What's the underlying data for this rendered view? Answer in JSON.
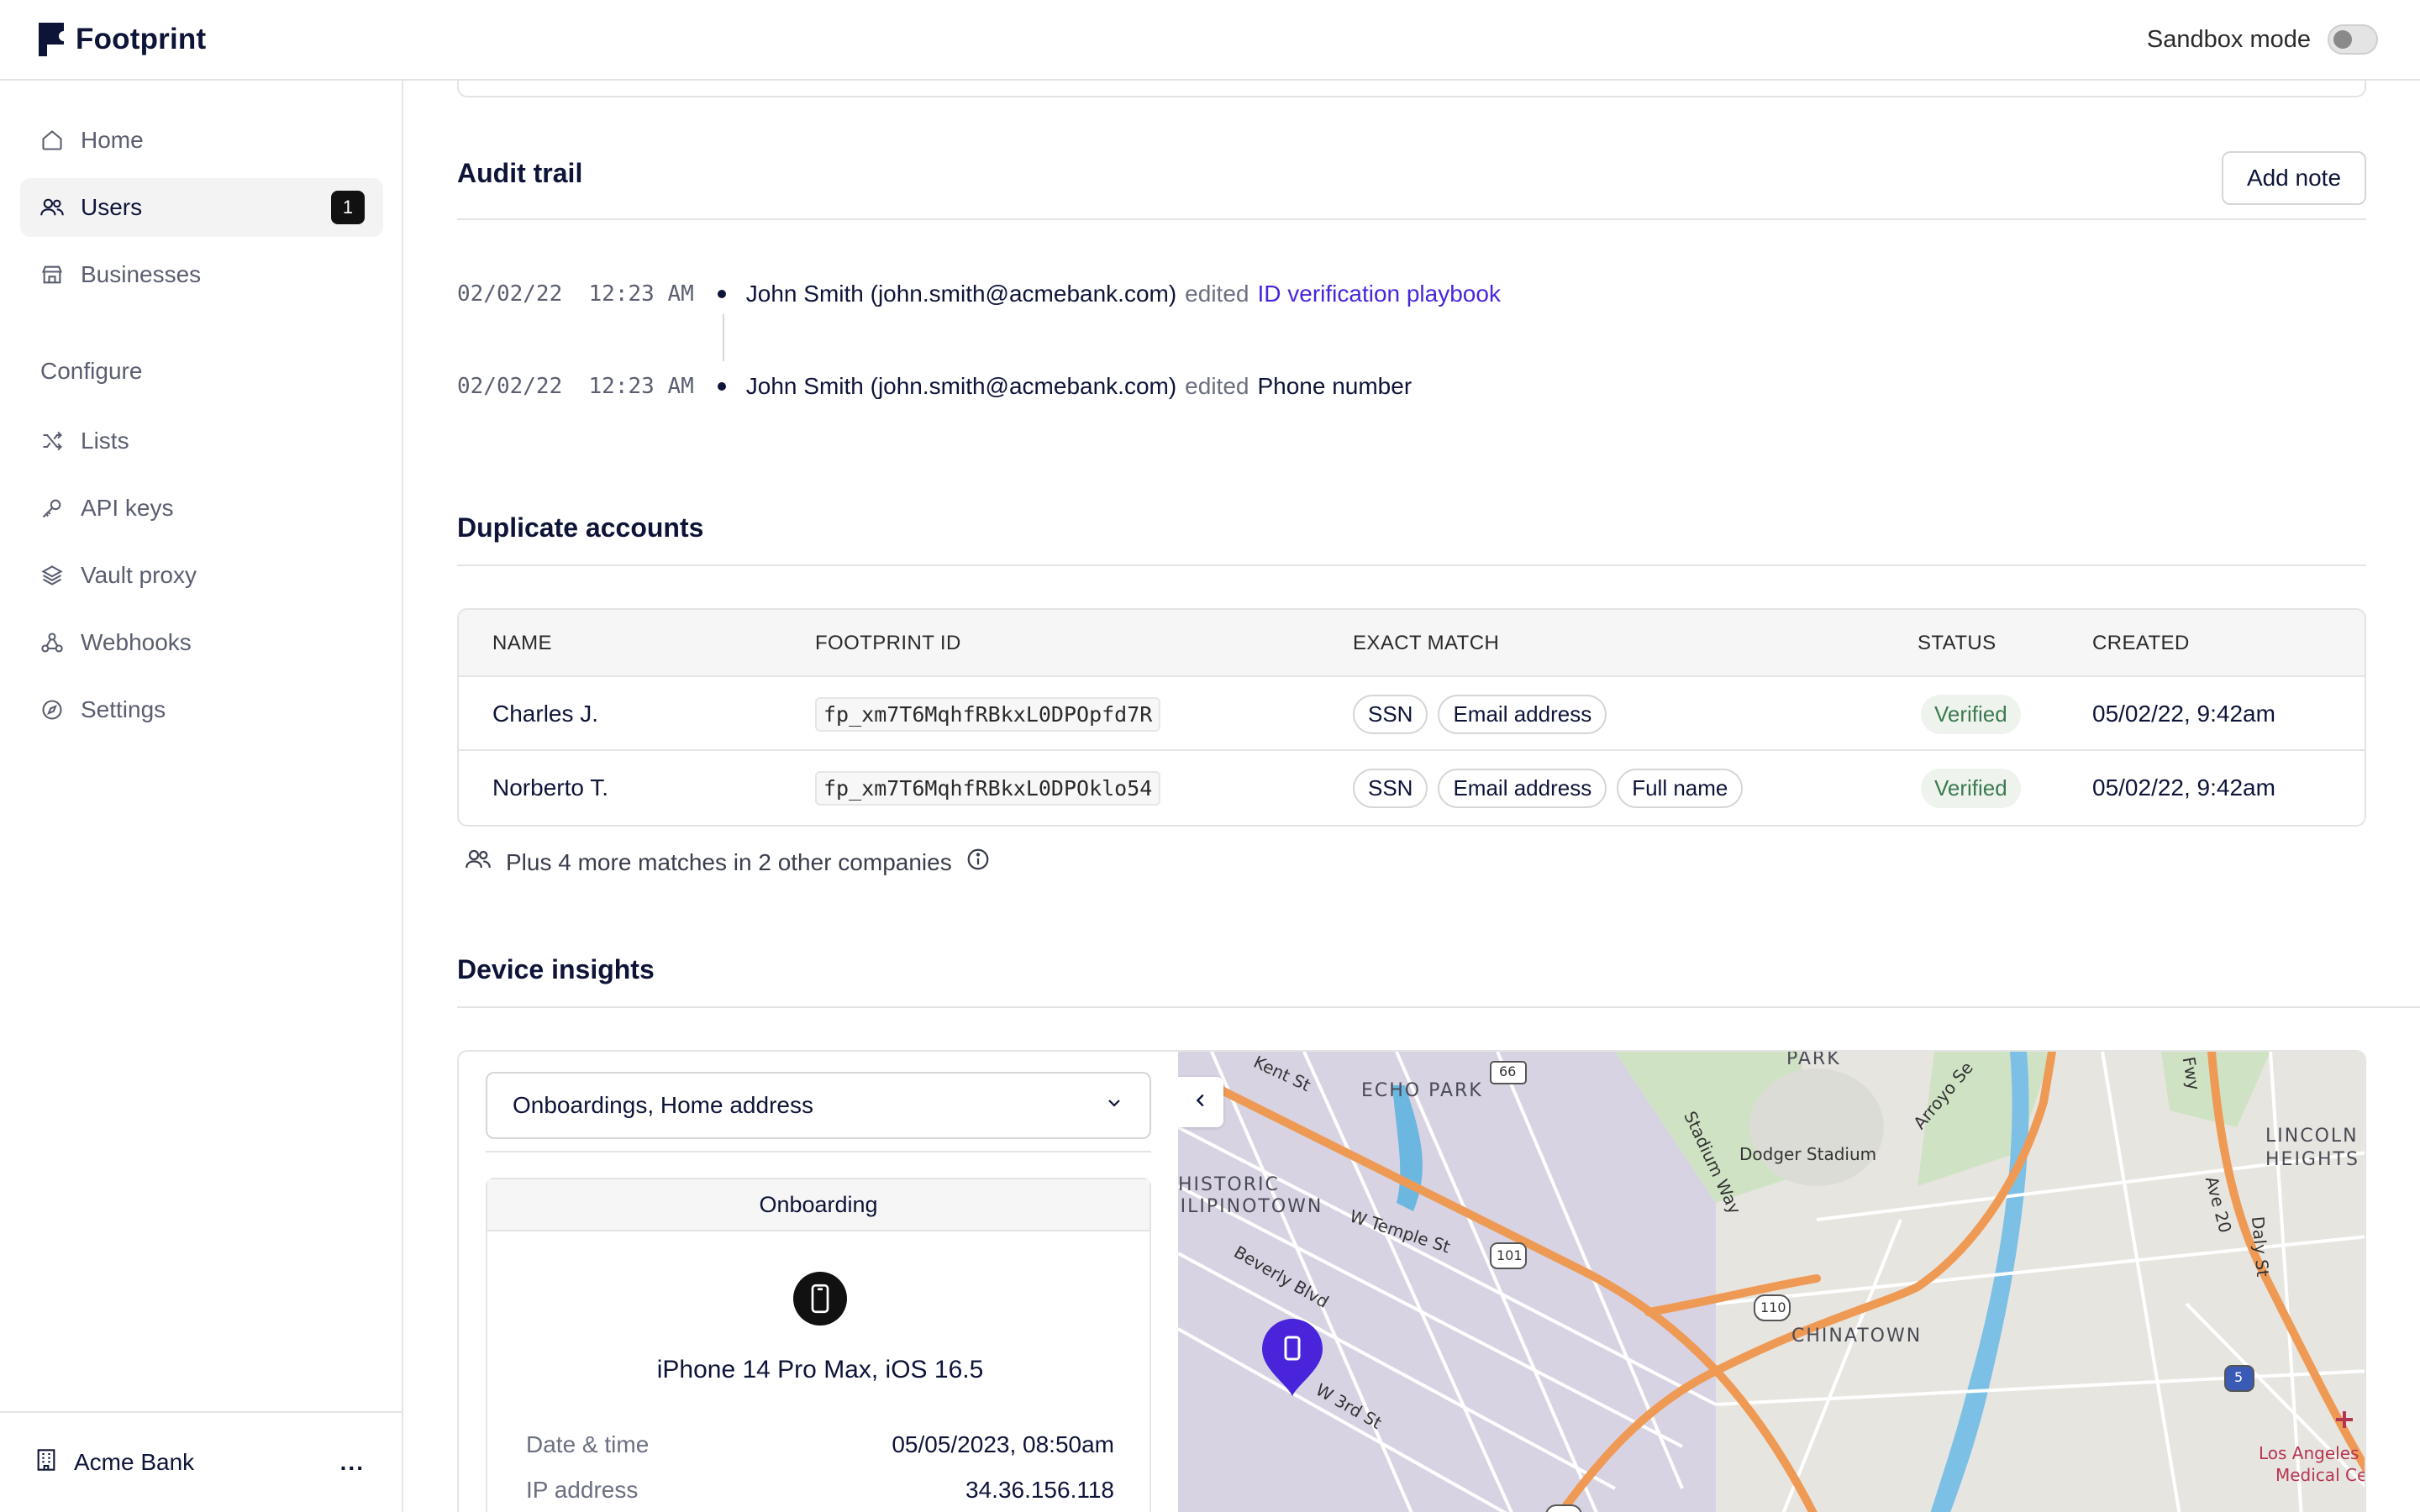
{
  "app": {
    "name": "Footprint"
  },
  "topbar": {
    "sandbox_label": "Sandbox mode"
  },
  "sidebar": {
    "items": [
      {
        "label": "Home",
        "icon": "home-icon"
      },
      {
        "label": "Users",
        "icon": "users-icon",
        "badge": "1",
        "active": true
      },
      {
        "label": "Businesses",
        "icon": "store-icon"
      }
    ],
    "section_label": "Configure",
    "config_items": [
      {
        "label": "Lists",
        "icon": "shuffle-icon"
      },
      {
        "label": "API keys",
        "icon": "key-icon"
      },
      {
        "label": "Vault proxy",
        "icon": "layers-icon"
      },
      {
        "label": "Webhooks",
        "icon": "webhook-icon"
      },
      {
        "label": "Settings",
        "icon": "settings-icon"
      }
    ],
    "org_name": "Acme Bank",
    "org_menu": "..."
  },
  "audit": {
    "title": "Audit trail",
    "add_note": "Add note",
    "entries": [
      {
        "timestamp": "02/02/22  12:23 AM",
        "actor": "John Smith (john.smith@acmebank.com)",
        "verb": "edited",
        "target": "ID verification playbook"
      },
      {
        "timestamp": "02/02/22  12:23 AM",
        "actor": "John Smith (john.smith@acmebank.com)",
        "verb": "edited",
        "target": "Phone number"
      }
    ]
  },
  "duplicates": {
    "title": "Duplicate accounts",
    "columns": [
      "NAME",
      "FOOTPRINT ID",
      "EXACT MATCH",
      "STATUS",
      "CREATED"
    ],
    "rows": [
      {
        "name": "Charles J.",
        "id": "fp_xm7T6MqhfRBkxL0DPOpfd7R",
        "matches": [
          "SSN",
          "Email address"
        ],
        "status": "Verified",
        "created": "05/02/22, 9:42am"
      },
      {
        "name": "Norberto T.",
        "id": "fp_xm7T6MqhfRBkxL0DPOklo54",
        "matches": [
          "SSN",
          "Email address",
          "Full name"
        ],
        "status": "Verified",
        "created": "05/02/22, 9:42am"
      }
    ],
    "more_text": "Plus 4 more matches in 2 other companies"
  },
  "device": {
    "title": "Device insights",
    "filter_value": "Onboardings, Home address",
    "card_title": "Onboarding",
    "device_name": "iPhone 14 Pro Max, iOS 16.5",
    "fields": [
      {
        "label": "Date & time",
        "value": "05/05/2023, 08:50am"
      },
      {
        "label": "IP address",
        "value": "34.36.156.118"
      }
    ]
  },
  "map": {
    "labels": {
      "park": "PARK",
      "echo_park": "ECHO PARK",
      "historic1": "HISTORIC",
      "historic2": "FILIPINOTOWN",
      "chinatown": "CHINATOWN",
      "lincoln1": "LINCOLN",
      "lincoln2": "HEIGHTS",
      "dodger": "Dodger Stadium",
      "kent": "Kent St",
      "stadium_way": "Stadium Way",
      "temple": "W Temple St",
      "beverly": "Beverly Blvd",
      "third": "W 3rd St",
      "arroyo": "Arroyo Se",
      "ave20": "Ave 20",
      "daly": "Daly St",
      "fwy": "Fwy",
      "lac1": "Los Angeles G",
      "lac2": "Medical Cer",
      "r66": "66",
      "r101a": "101",
      "r101b": "101",
      "r110a": "110",
      "r110b": "110",
      "r5": "5"
    }
  }
}
